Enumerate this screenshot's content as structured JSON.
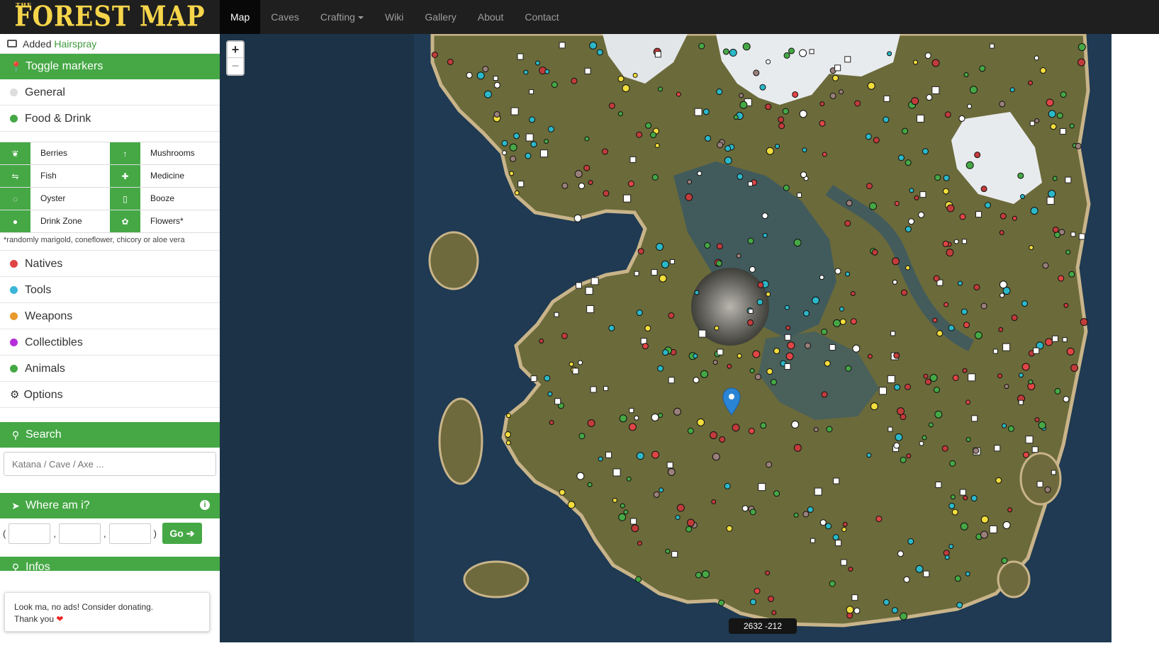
{
  "brand": {
    "the": "THE",
    "name": "FOREST MAP"
  },
  "nav": [
    {
      "label": "Map",
      "active": true
    },
    {
      "label": "Caves"
    },
    {
      "label": "Crafting",
      "dropdown": true
    },
    {
      "label": "Wiki"
    },
    {
      "label": "Gallery"
    },
    {
      "label": "About"
    },
    {
      "label": "Contact"
    }
  ],
  "news": {
    "prefix": "Added",
    "highlight": "Hairspray"
  },
  "toggle_header": "Toggle markers",
  "categories_top": [
    {
      "label": "General",
      "color": "#dddddd"
    },
    {
      "label": "Food & Drink",
      "color": "#45a845"
    }
  ],
  "food_sub": [
    {
      "label": "Berries",
      "icon": "leaf-icon"
    },
    {
      "label": "Mushrooms",
      "icon": "mushroom-icon"
    },
    {
      "label": "Fish",
      "icon": "fish-icon"
    },
    {
      "label": "Medicine",
      "icon": "medicine-icon"
    },
    {
      "label": "Oyster",
      "icon": "oyster-icon"
    },
    {
      "label": "Booze",
      "icon": "bottle-icon"
    },
    {
      "label": "Drink Zone",
      "icon": "water-drop-icon"
    },
    {
      "label": "Flowers*",
      "icon": "flower-icon"
    }
  ],
  "footnote": "*randomly marigold, coneflower, chicory or aloe vera",
  "categories_bottom": [
    {
      "label": "Natives",
      "color": "#e04545"
    },
    {
      "label": "Tools",
      "color": "#3bb5d8"
    },
    {
      "label": "Weapons",
      "color": "#e89a2e"
    },
    {
      "label": "Collectibles",
      "color": "#b52ed8"
    },
    {
      "label": "Animals",
      "color": "#45a845"
    }
  ],
  "options_label": "Options",
  "search": {
    "header": "Search",
    "placeholder": "Katana / Cave / Axe ..."
  },
  "where": {
    "header": "Where am i?",
    "go": "Go",
    "open_paren": "(",
    "close_paren": ")",
    "comma": ","
  },
  "infos": {
    "header": "Infos"
  },
  "donate": {
    "line1": "Look ma, no ads! Consider donating.",
    "line2": "Thank you",
    "heart": "❤"
  },
  "map": {
    "coord_readout": "2632 -212",
    "zoom_in": "+",
    "zoom_out": "−",
    "sea_color": "#1c3347",
    "land_color": "#6b6a3a",
    "snow_color": "#e8ebee"
  }
}
